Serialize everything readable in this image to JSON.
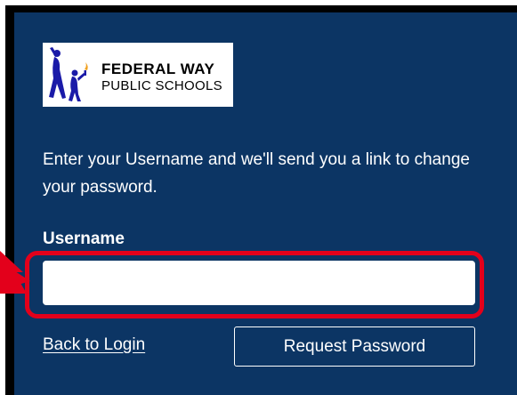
{
  "logo": {
    "line1": "FEDERAL WAY",
    "line2": "PUBLIC SCHOOLS",
    "icon": "figures-with-torch-icon"
  },
  "form": {
    "instructions": "Enter your Username and we'll send you a link to change your password.",
    "username_label": "Username",
    "username_value": "",
    "username_placeholder": "",
    "back_link_label": "Back to Login",
    "submit_label": "Request Password"
  },
  "colors": {
    "panel_background": "#0c3564",
    "highlight": "#e3001b",
    "text": "#ffffff"
  },
  "annotation": {
    "arrow_icon": "red-arrow-icon"
  }
}
